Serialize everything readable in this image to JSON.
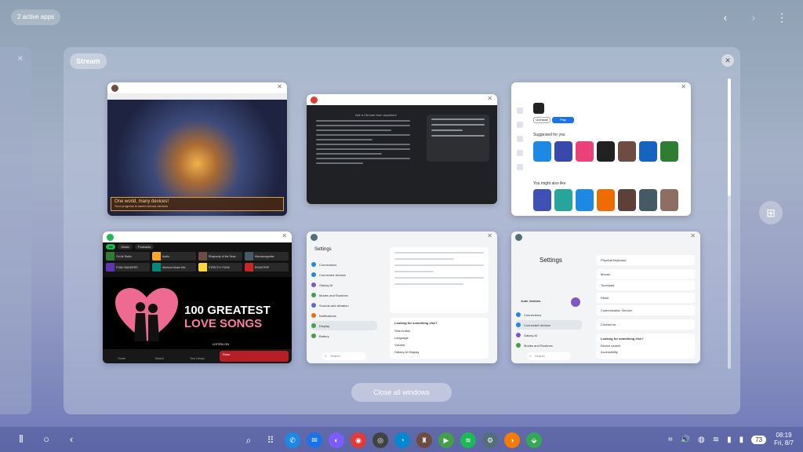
{
  "top": {
    "active_apps": "2 active apps"
  },
  "panel": {
    "title": "Stream",
    "close_all": "Close all windows"
  },
  "game": {
    "banner_title": "One world, many devices!",
    "banner_sub": "Your progress is saved across devices"
  },
  "chrome_doc": {
    "heading": "Ask a Chrome from anywhere"
  },
  "playstore": {
    "uninstall": "Uninstall",
    "install": "Play",
    "suggested": "Suggested for you",
    "might_like": "You might also like",
    "app_colors_1": [
      "#1e88e5",
      "#3949ab",
      "#ec407a",
      "#212121",
      "#6d4c41",
      "#1565c0",
      "#2e7d32"
    ],
    "app_colors_2": [
      "#3f51b5",
      "#26a69a",
      "#1e88e5",
      "#ef6c00",
      "#5d4037",
      "#455a64",
      "#8d6e63"
    ]
  },
  "spotify": {
    "chips": [
      "All",
      "Music",
      "Podcasts"
    ],
    "tiles": [
      {
        "label": "On Air Radio",
        "color": "#2e7d32"
      },
      {
        "label": "Audio",
        "color": "#f9a825"
      },
      {
        "label": "Rhapsody of the Seas",
        "color": "#6d4c41"
      },
      {
        "label": "Microsongwriter",
        "color": "#455a64"
      },
      {
        "label": "FUNK BANGERS",
        "color": "#5e35b1"
      },
      {
        "label": "Workout Music Mix",
        "color": "#00897b"
      },
      {
        "label": "STRICTLY FUNK",
        "color": "#fdd835"
      },
      {
        "label": "ROADTRIP",
        "color": "#c62828"
      }
    ],
    "ad_line1": "100 GREATEST",
    "ad_line2": "LOVE SONGS",
    "listen_on": "LISTEN ON",
    "nav": [
      "Home",
      "Search",
      "Your Library",
      "Premium",
      "Create"
    ],
    "now_playing": "Rosa"
  },
  "settings1": {
    "title": "Settings",
    "items": [
      "Connections",
      "Connected devices",
      "Galaxy AI",
      "Modes and Routines",
      "Sounds and vibration",
      "Notifications",
      "Display",
      "Battery"
    ],
    "looking": "Looking for something else?",
    "links": [
      "Side button",
      "Language",
      "Volume",
      "Galaxy AI Display"
    ],
    "search": "Search"
  },
  "settings2": {
    "title": "Settings",
    "user": "Jude Jenkins",
    "items": [
      "Connections",
      "Connected devices",
      "Galaxy AI",
      "Modes and Routines"
    ],
    "right_items": [
      "Physical keyboard",
      "Mouse",
      "Touchpad",
      "Reset",
      "Customization Service",
      "Contact us"
    ],
    "looking": "Looking for something else?",
    "links": [
      "Device search",
      "Accessibility"
    ],
    "search": "Search"
  },
  "taskbar": {
    "apps": [
      {
        "name": "phone-icon",
        "color": "#1e88e5",
        "glyph": "✆"
      },
      {
        "name": "messages-icon",
        "color": "#1a73e8",
        "glyph": "✉"
      },
      {
        "name": "messenger-icon",
        "color": "#7b5cff",
        "glyph": "◐"
      },
      {
        "name": "chrome-icon",
        "color": "#e53935",
        "glyph": "◉"
      },
      {
        "name": "camera-icon",
        "color": "#424242",
        "glyph": "◎"
      },
      {
        "name": "edge-icon",
        "color": "#0288d1",
        "glyph": "◔"
      },
      {
        "name": "game-icon",
        "color": "#6d4c41",
        "glyph": "♜"
      },
      {
        "name": "play-store-icon",
        "color": "#43a047",
        "glyph": "▶"
      },
      {
        "name": "spotify-icon",
        "color": "#1db954",
        "glyph": "≋"
      },
      {
        "name": "settings-icon",
        "color": "#546e7a",
        "glyph": "⚙"
      },
      {
        "name": "crunchyroll-icon",
        "color": "#f57c00",
        "glyph": "◑"
      },
      {
        "name": "maps-icon",
        "color": "#34a853",
        "glyph": "⬙"
      }
    ],
    "battery": "73",
    "time": "08:19",
    "date": "Fri, 8/7"
  }
}
